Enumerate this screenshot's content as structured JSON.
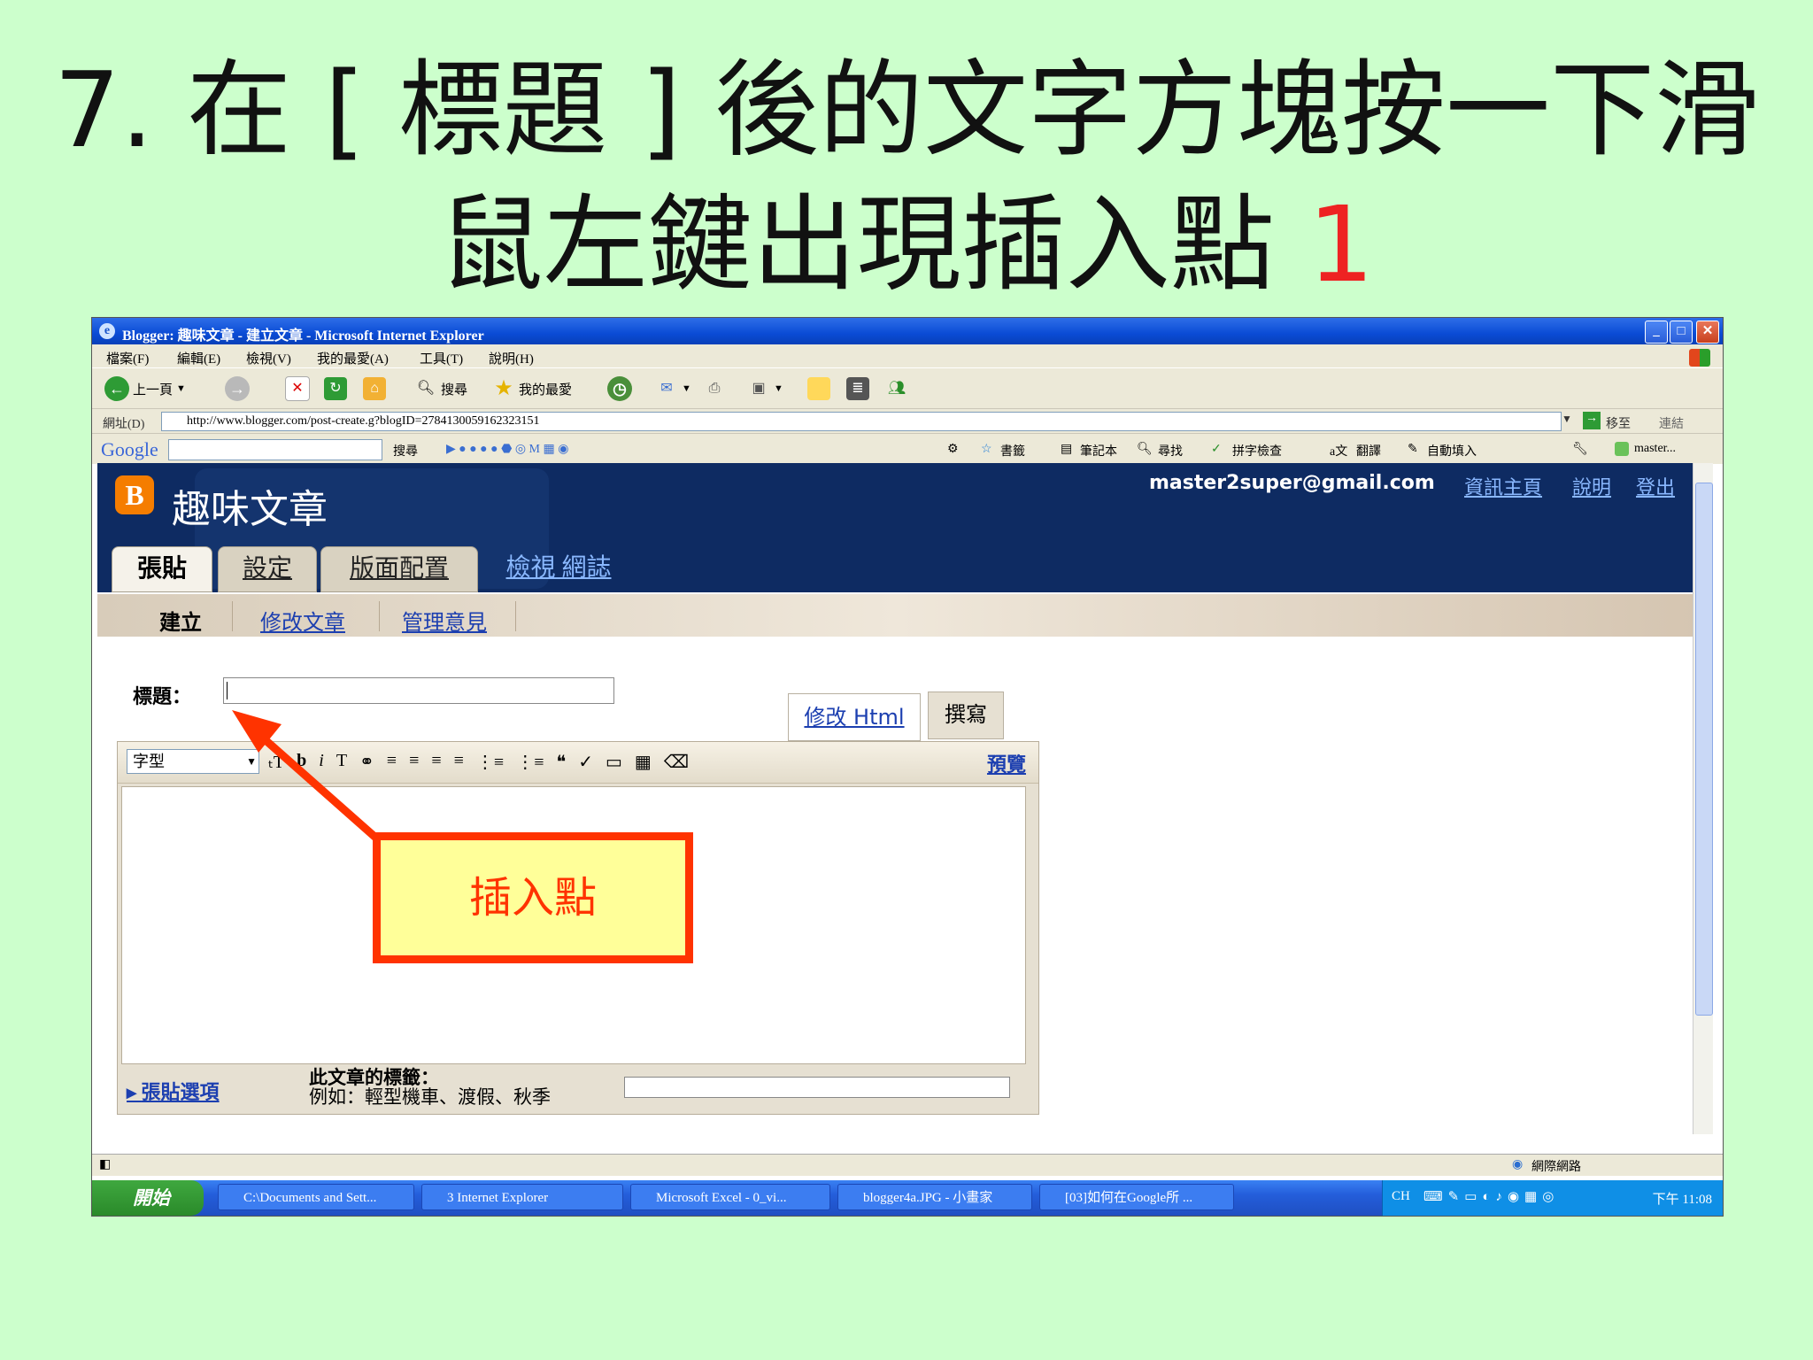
{
  "slide": {
    "title_line1": "7. 在 [ 標題 ] 後的文字方塊按一下滑",
    "title_line2": "鼠左鍵出現插入點",
    "step_number": "1",
    "accent_color": "#ff3300",
    "background": "#ccffcc"
  },
  "browser": {
    "title": "Blogger: 趣味文章 - 建立文章 - Microsoft Internet Explorer",
    "window_buttons": [
      "minimize",
      "maximize",
      "close"
    ],
    "menu": [
      "檔案(F)",
      "編輯(E)",
      "檢視(V)",
      "我的最愛(A)",
      "工具(T)",
      "說明(H)"
    ],
    "toolbar": {
      "back_label": "上一頁",
      "search_label": "搜尋",
      "favorites_label": "我的最愛"
    },
    "address": {
      "label": "網址(D)",
      "url": "http://www.blogger.com/post-create.g?blogID=2784130059162323151",
      "go_label": "移至",
      "links_label": "連結"
    },
    "google_bar": {
      "logo": "Google",
      "search_label": "搜尋",
      "bookmarks_label": "書籤",
      "notebook_label": "筆記本",
      "find_label": "尋找",
      "spellcheck_label": "拼字檢查",
      "translate_label": "翻譯",
      "autofill_label": "自動填入",
      "user_label": "master..."
    },
    "status": {
      "zone": "網際網路"
    }
  },
  "blogger": {
    "blog_name": "趣味文章",
    "email": "master2super@gmail.com",
    "header_links": [
      "資訊主頁",
      "說明",
      "登出"
    ],
    "tabs": [
      {
        "label": "張貼",
        "active": true
      },
      {
        "label": "設定",
        "active": false
      },
      {
        "label": "版面配置",
        "active": false
      },
      {
        "label": "檢視 網誌",
        "active": false
      }
    ],
    "subtabs": [
      {
        "label": "建立",
        "active": true
      },
      {
        "label": "修改文章",
        "active": false
      },
      {
        "label": "管理意見",
        "active": false
      }
    ],
    "title_label": "標題：",
    "title_value": "",
    "mode_tabs": [
      "修改 Html",
      "撰寫"
    ],
    "font_select": "字型",
    "preview_label": "預覽",
    "post_options_label": "張貼選項",
    "tags_label": "此文章的標籤：",
    "tags_example": "例如：輕型機車、渡假、秋季",
    "tags_value": ""
  },
  "callout": {
    "label": "插入點",
    "fill": "#ffff99",
    "border": "#ff3300"
  },
  "taskbar": {
    "start_label": "開始",
    "items": [
      "C:\\Documents and Sett...",
      "3 Internet Explorer",
      "Microsoft Excel - 0_vi...",
      "blogger4a.JPG - 小畫家",
      "[03]如何在Google所 ..."
    ],
    "lang": "CH",
    "clock": "下午 11:08"
  }
}
